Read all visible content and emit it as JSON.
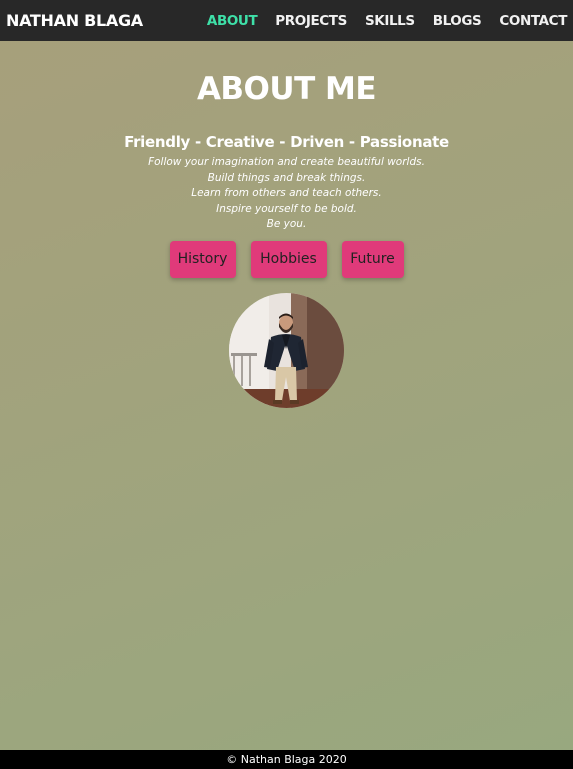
{
  "nav": {
    "brand": "NATHAN BLAGA",
    "links": [
      {
        "label": "ABOUT"
      },
      {
        "label": "PROJECTS"
      },
      {
        "label": "SKILLS"
      },
      {
        "label": "BLOGS"
      },
      {
        "label": "CONTACT"
      }
    ],
    "active_color": "#3ee0a8"
  },
  "main": {
    "title": "ABOUT ME",
    "tagline": "Friendly - Creative - Driven - Passionate",
    "motto": [
      "Follow your imagination and create beautiful worlds.",
      "Build things and break things.",
      "Learn from others and teach others.",
      "Inspire yourself to be bold.",
      "Be you."
    ],
    "buttons": [
      {
        "label": "History"
      },
      {
        "label": "Hobbies"
      },
      {
        "label": "Future"
      }
    ],
    "button_color": "#e03a7a"
  },
  "footer": {
    "text": "© Nathan Blaga 2020"
  }
}
